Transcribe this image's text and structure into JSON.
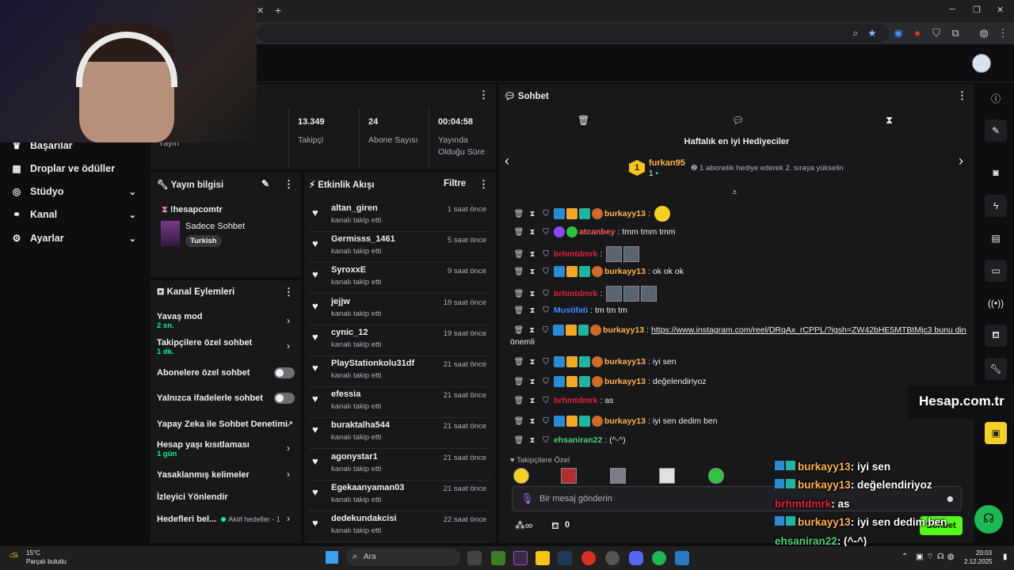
{
  "sidebar": {
    "items": [
      {
        "label": "Başarılar",
        "icon": "trophy-icon"
      },
      {
        "label": "Droplar ve ödüller",
        "icon": "gift-icon"
      },
      {
        "label": "Stüdyo",
        "icon": "studio-icon"
      },
      {
        "label": "Kanal",
        "icon": "channel-icon"
      },
      {
        "label": "Ayarlar",
        "icon": "gear-icon"
      }
    ]
  },
  "stats": {
    "partial_label": "Yayın",
    "followers": "13.349",
    "followers_label": "Takipçi",
    "subs": "24",
    "subs_label": "Abone Sayısı",
    "uptime": "00:04:58",
    "uptime_label": "Yayında Olduğu Süre"
  },
  "stream_info": {
    "title": "Yayın bilgisi",
    "command": "!hesapcomtr",
    "category": "Sadece Sohbet",
    "tag": "Turkish"
  },
  "channel_actions": {
    "title": "Kanal Eylemleri",
    "slow_mode": "Yavaş mod",
    "slow_mode_value": "2 sn.",
    "followers_chat": "Takipçilere özel sohbet",
    "followers_chat_value": "1 dk.",
    "subs_chat": "Abonelere özel sohbet",
    "emote_chat": "Yalnızca ifadelerle sohbet",
    "ai_mod": "Yapay Zeka ile Sohbet Denetimi",
    "age": "Hesap yaşı kısıtlaması",
    "age_value": "1 gün",
    "banned_words": "Yasaklanmış kelimeler",
    "redirect": "İzleyici Yönlendir",
    "goals": "Hedefleri bel...",
    "goals_value": "Aktif hedefler - 1"
  },
  "activity": {
    "title": "Etkinlik Akışı",
    "filter": "Filtre",
    "events": [
      {
        "name": "altan_giren",
        "sub": "kanalı takip etti",
        "time": "1 saat önce"
      },
      {
        "name": "Germisss_1461",
        "sub": "kanalı takip etti",
        "time": "5 saat önce"
      },
      {
        "name": "SyroxxE",
        "sub": "kanalı takip etti",
        "time": "9 saat önce"
      },
      {
        "name": "jejjw",
        "sub": "kanalı takip etti",
        "time": "18 saat önce"
      },
      {
        "name": "cynic_12",
        "sub": "kanalı takip etti",
        "time": "19 saat önce"
      },
      {
        "name": "PlayStationkolu31df",
        "sub": "kanalı takip etti",
        "time": "21 saat önce"
      },
      {
        "name": "efessia",
        "sub": "kanalı takip etti",
        "time": "21 saat önce"
      },
      {
        "name": "buraktalha544",
        "sub": "kanalı takip etti",
        "time": "21 saat önce"
      },
      {
        "name": "agonystar1",
        "sub": "kanalı takip etti",
        "time": "21 saat önce"
      },
      {
        "name": "Egekaanyaman03",
        "sub": "kanalı takip etti",
        "time": "21 saat önce"
      },
      {
        "name": "dedekundakcisi",
        "sub": "kanalı takip etti",
        "time": "22 saat önce"
      }
    ]
  },
  "chat": {
    "title": "Sohbet",
    "gifters_title": "Haftalık en iyi Hediyeciler",
    "top_gifter": "furkan95",
    "top_rank": "1",
    "top_count": "1",
    "gifter_note": "1 abonelik hediye ederek 2. sıraya yükselin",
    "messages": [
      {
        "user": "burkayy13",
        "color": "#ffb347",
        "text": ""
      },
      {
        "user": "atcanbey",
        "color": "#ff5b5b",
        "text": "tmm tmm tmm"
      },
      {
        "user": "brhmtdmrk",
        "color": "#e0203a",
        "text": ""
      },
      {
        "user": "burkayy13",
        "color": "#ffb347",
        "text": "ok ok ok"
      },
      {
        "user": "brhmtdmrk",
        "color": "#e0203a",
        "text": ""
      },
      {
        "user": "Mustifati",
        "color": "#3d8bff",
        "text": "tm tm tm"
      },
      {
        "user": "burkayy13",
        "color": "#ffb347",
        "text": "https://www.instagram.com/reel/DRqAx_rCPPL/?igsh=ZW42bHE5MTBtMjc3 bunu dinle"
      },
      {
        "user": "burkayy13",
        "color": "#ffb347",
        "text": "iyi sen"
      },
      {
        "user": "burkayy13",
        "color": "#ffb347",
        "text": "değelendiriyoz"
      },
      {
        "user": "brhmtdmrk",
        "color": "#e0203a",
        "text": "as"
      },
      {
        "user": "burkayy13",
        "color": "#ffb347",
        "text": "iyi sen dedim ben"
      },
      {
        "user": "ehsaniran22",
        "color": "#4cd17a",
        "text": "(^-^)"
      }
    ],
    "wrap_text": "önemli",
    "followers_only": "Takipçilere Özel",
    "placeholder": "Bir mesaj gönderin",
    "viewer_count": "0",
    "send": "Sohbet"
  },
  "overlay": {
    "brand": "Hesap.com.tr",
    "lines": [
      {
        "user": "burkayy13",
        "text": ": iyi sen"
      },
      {
        "user": "burkayy13",
        "text": ": değelendiriyoz"
      },
      {
        "user": "brhmtdmrk",
        "text": ": as"
      },
      {
        "user": "burkayy13",
        "text": ": iyi sen dedim ben"
      },
      {
        "user": "ehsaniran22",
        "text": ": (^-^)"
      }
    ]
  },
  "taskbar": {
    "weather_temp": "15°C",
    "weather_desc": "Parçalı bulutlu",
    "search": "Ara",
    "time": "20:03",
    "date": "2.12.2025"
  }
}
